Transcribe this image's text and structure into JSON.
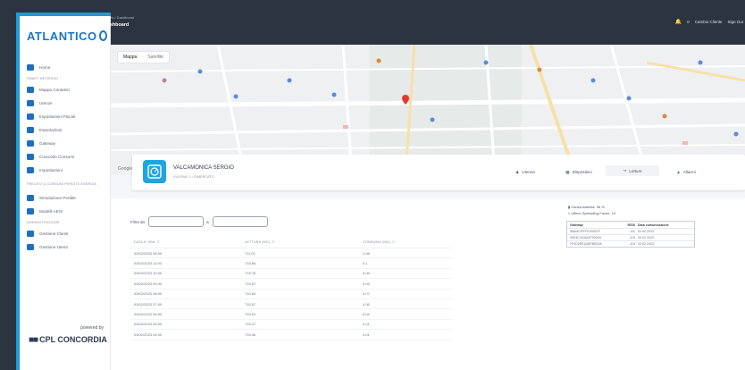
{
  "brand": {
    "logo_text": "ATLANTICO",
    "powered_by": "powered by",
    "company": "CPL CONCORDIA"
  },
  "header": {
    "breadcrumb": "Pages / Dashboard",
    "title": "Dashboard",
    "notifications": "0",
    "change_client": "Cambio Cliente",
    "sign_out": "Sign Out"
  },
  "sidebar": {
    "home": "Home",
    "section_smart_metering": "SMART METERING",
    "items": [
      "Mappa Contatori",
      "Utenze",
      "Impostazioni Fiscali",
      "Esportazioni",
      "Gateway",
      "Cruscotto Consumi",
      "Impostazioni"
    ],
    "section_preventive": "PRELIEVI & CONSUMI PERDITE ENERGIA",
    "items2": [
      "Simulazione Perdite",
      "Modelli AEGI"
    ],
    "section_admin": "AMMINISTRAZIONE",
    "items3": [
      "Gestione Clienti",
      "Gestione Utenti"
    ]
  },
  "map": {
    "tab_map": "Mappa",
    "tab_satellite": "Satellite",
    "google": "Google"
  },
  "customer": {
    "name": "VALCAMONICA SERGIO",
    "address": "VIA RIVA, 1 / GIMERCATO",
    "tabs": [
      "Utenza",
      "Dispositivo",
      "Letture",
      "Allarmi"
    ]
  },
  "readings": {
    "filter_from": "Filtra da:",
    "filter_to": "a:",
    "headers": [
      "DATA E ORA",
      "LETTURA (MC)",
      "CONSUMO (MC)"
    ],
    "rows": [
      [
        "03/02/2023 08:00",
        "711.01",
        "1.06"
      ],
      [
        "03/02/2023 11:00",
        "715.86",
        "0.1"
      ],
      [
        "03/02/2023 10:00",
        "715.76",
        "0.09"
      ],
      [
        "03/02/2023 09:00",
        "715.67",
        "0.03"
      ],
      [
        "03/02/2023 08:00",
        "715.64",
        "0.07"
      ],
      [
        "03/02/2023 07:00",
        "715.57",
        "0.06"
      ],
      [
        "03/02/2023 06:00",
        "715.51",
        "0.04"
      ],
      [
        "03/02/2023 05:00",
        "715.47",
        "0.01"
      ],
      [
        "03/02/2023 04:00",
        "715.46",
        "0.01"
      ]
    ]
  },
  "device": {
    "battery": "Carica batteria: 98 %",
    "spreading": "Ultimo Spreading Factor: 10",
    "gateway_headers": [
      "Gateway",
      "RSSI",
      "Data comunicazione"
    ],
    "gateways": [
      [
        "58A0E4FFFE00907F",
        "-111",
        "03.02.2023"
      ],
      [
        "00E4C1DAA3F5000A",
        "-115",
        "03.02.2023"
      ],
      [
        "7F0D2EEA2BFBE00A",
        "-119",
        "03.02.2023"
      ]
    ]
  },
  "colors": {
    "accent": "#1f9bd6",
    "header": "#2c3440",
    "nav_icon": "#1f6fc0"
  }
}
